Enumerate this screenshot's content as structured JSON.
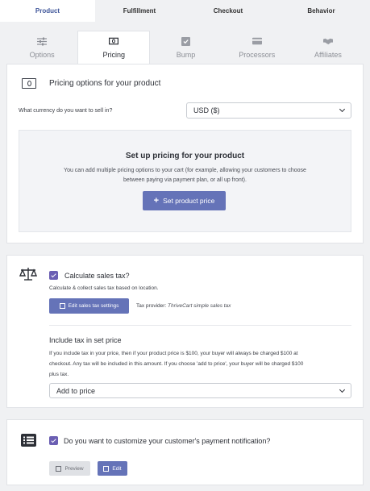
{
  "top_tabs": [
    {
      "label": "Product",
      "active": true
    },
    {
      "label": "Fulfillment",
      "active": false
    },
    {
      "label": "Checkout",
      "active": false
    },
    {
      "label": "Behavior",
      "active": false
    }
  ],
  "sub_tabs": [
    {
      "label": "Options",
      "icon": "sliders-icon",
      "active": false
    },
    {
      "label": "Pricing",
      "icon": "money-icon",
      "active": true
    },
    {
      "label": "Bump",
      "icon": "checkbox-icon",
      "active": false
    },
    {
      "label": "Processors",
      "icon": "credit-card-icon",
      "active": false
    },
    {
      "label": "Affiliates",
      "icon": "handshake-icon",
      "active": false
    }
  ],
  "pricing": {
    "title": "Pricing options for your product",
    "currency_label": "What currency do you want to sell in?",
    "currency_value": "USD ($)",
    "setup_title": "Set up pricing for your product",
    "setup_desc_line1": "You can add multiple pricing options to your cart (for example, allowing your customers to choose",
    "setup_desc_line2": "between paying via payment plan, or all up front).",
    "set_price_button": "Set product price"
  },
  "tax": {
    "checkbox_label": "Calculate sales tax?",
    "checked": true,
    "desc": "Calculate & collect sales tax based on location.",
    "edit_button": "Edit sales tax settings",
    "provider_label": "Tax provider: ",
    "provider_name": "ThriveCart simple sales tax",
    "include_heading": "Include tax in set price",
    "include_para_line1": "If you include tax in your price, then if your product price is $100, your buyer will always be charged $100 at",
    "include_para_line2": "checkout.  Any tax will be included in this amount.  If you choose 'add to price', your buyer will be charged $100",
    "include_para_line3": "plus tax.",
    "include_value": "Add to price"
  },
  "notification": {
    "checkbox_label": "Do you want to customize your customer's payment notification?",
    "checked": true,
    "preview_button": "Preview",
    "edit_button": "Edit"
  },
  "colors": {
    "accent": "#6573b8",
    "checkbox": "#6b5fb3",
    "active_tab_text": "#3e5599",
    "background": "#f0f1f3"
  }
}
